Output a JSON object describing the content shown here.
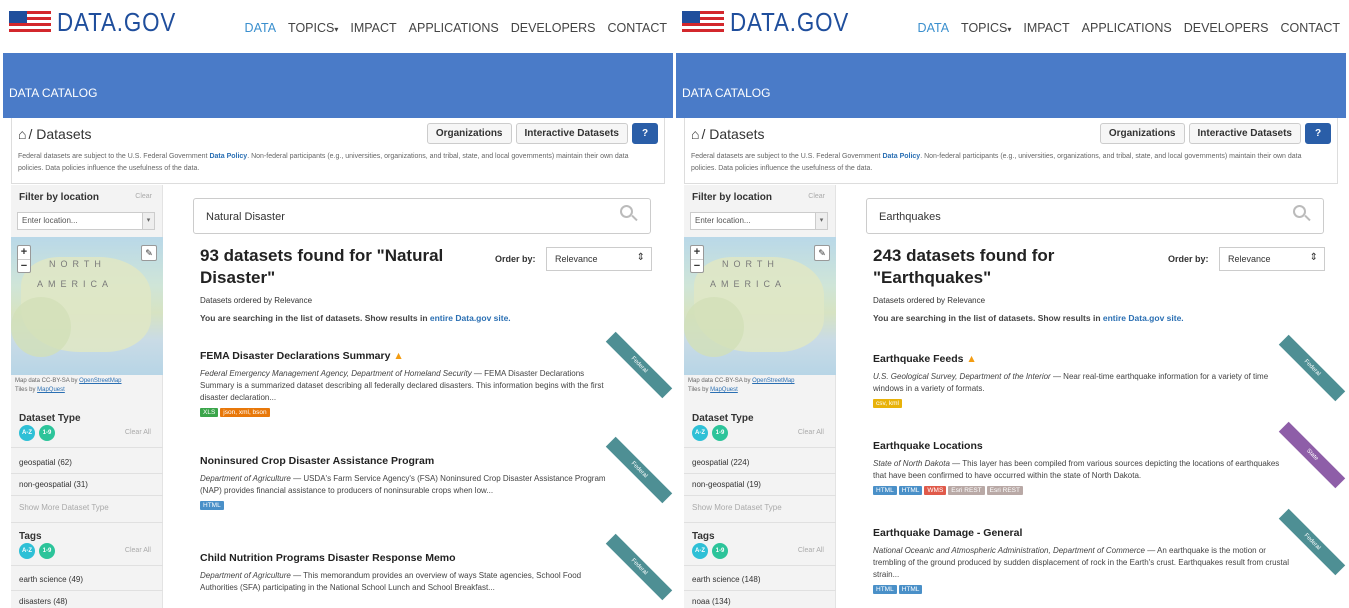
{
  "site": {
    "logo_text": "DATA.GOV",
    "nav": [
      "DATA",
      "TOPICS",
      "IMPACT",
      "APPLICATIONS",
      "DEVELOPERS",
      "CONTACT"
    ],
    "banner": "DATA CATALOG",
    "breadcrumb": "/ Datasets",
    "buttons": {
      "organizations": "Organizations",
      "interactive": "Interactive Datasets",
      "help": "?"
    },
    "disclaimer_pre": "Federal datasets are subject to the U.S. Federal Government",
    "disclaimer_link": "Data Policy",
    "disclaimer_post": ". Non-federal participants (e.g., universities, organizations, and tribal, state, and local governments) maintain their own data policies. Data policies influence the usefulness of the data.",
    "filter_location": "Filter by location",
    "clear": "Clear",
    "location_placeholder": "Enter location...",
    "map_word1": "NORTH",
    "map_word2": "AMERICA",
    "attrib1": "Map data CC-BY-SA by",
    "attrib1_link": "OpenStreetMap",
    "attrib2": "Tiles by",
    "attrib2_link": "MapQuest",
    "dataset_type": "Dataset Type",
    "clear_all": "Clear All",
    "show_more_types": "Show More Dataset Type",
    "tags_title": "Tags",
    "chip_az": "A-Z",
    "chip_19": "1-9",
    "order_by": "Order by:",
    "order_value": "Relevance",
    "ordered_by": "Datasets ordered by Relevance",
    "scope_pre": "You are searching in the list of datasets. Show results in",
    "scope_link": "entire Data.gov site."
  },
  "left": {
    "query": "Natural Disaster",
    "heading": "93 datasets found for \"Natural Disaster\"",
    "types": [
      "geospatial (62)",
      "non-geospatial (31)"
    ],
    "tags": [
      "earth science (49)",
      "disasters (48)"
    ],
    "results": [
      {
        "title": "FEMA Disaster Declarations Summary",
        "agency": "Federal Emergency Management Agency, Department of Homeland Security",
        "desc": "FEMA Disaster Declarations Summary is a summarized dataset describing all federally declared disasters. This information begins with the first disaster declaration...",
        "formats": [
          "XLS",
          "json, xml, bson"
        ],
        "ribbon": "Federal"
      },
      {
        "title": "Noninsured Crop Disaster Assistance Program",
        "agency": "Department of Agriculture",
        "desc": "USDA's Farm Service Agency's (FSA) Noninsured Crop Disaster Assistance Program (NAP) provides financial assistance to producers of noninsurable crops when low...",
        "formats": [
          "HTML"
        ],
        "ribbon": "Federal"
      },
      {
        "title": "Child Nutrition Programs Disaster Response Memo",
        "agency": "Department of Agriculture",
        "desc": "This memorandum provides an overview of ways State agencies, School Food Authorities (SFA) participating in the National School Lunch and School Breakfast...",
        "formats": [],
        "ribbon": "Federal"
      }
    ]
  },
  "right": {
    "query": "Earthquakes",
    "heading": "243 datasets found for \"Earthquakes\"",
    "types": [
      "geospatial (224)",
      "non-geospatial (19)"
    ],
    "tags": [
      "earth science (148)",
      "noaa (134)"
    ],
    "results": [
      {
        "title": "Earthquake Feeds",
        "agency": "U.S. Geological Survey, Department of the Interior",
        "desc": "Near real-time earthquake information for a variety of time windows in a variety of formats.",
        "formats": [
          "csv, kml"
        ],
        "ribbon": "Federal"
      },
      {
        "title": "Earthquake Locations",
        "agency": "State of North Dakota",
        "desc": "This layer has been compiled from various sources depicting the locations of earthquakes that have been confirmed to have occurred within the state of North Dakota.",
        "formats": [
          "HTML",
          "HTML",
          "WMS",
          "Esri REST",
          "Esri REST"
        ],
        "ribbon": "State"
      },
      {
        "title": "Earthquake Damage - General",
        "agency": "National Oceanic and Atmospheric Administration, Department of Commerce",
        "desc": "An earthquake is the motion or trembling of the ground produced by sudden displacement of rock in the Earth's crust. Earthquakes result from crustal strain...",
        "formats": [
          "HTML",
          "HTML"
        ],
        "ribbon": "Federal"
      }
    ]
  },
  "colors": {
    "banner": "#4a7bc8",
    "link": "#2a6fb3",
    "ribbon_federal": "#4e8f94",
    "ribbon_state": "#8e5ea8",
    "tag_xls": "#3aa54a",
    "tag_json": "#e8780a",
    "tag_html": "#4a90c8",
    "tag_wms": "#e05a4a",
    "tag_esri": "#b9a9a6",
    "tag_csv": "#e8b20a"
  }
}
